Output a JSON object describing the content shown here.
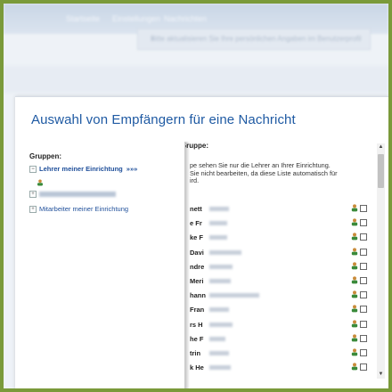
{
  "background": {
    "nav_items": [
      "Startseite",
      "Einstellungen",
      "Nachrichten"
    ],
    "notice_text": "Bitte aktualisieren Sie Ihre persönlichen Angaben im Benutzerprofil",
    "notice_close": "×"
  },
  "dialog": {
    "title": "Auswahl von Empfängern für eine Nachricht"
  },
  "groups": {
    "heading": "Gruppen:",
    "items": [
      {
        "sign": "−",
        "label": "Lehrer meiner Einrichtung",
        "arrows": "»»»",
        "selected": true
      },
      {
        "sign": "+",
        "label": ""
      },
      {
        "sign": "+",
        "label": "Mitarbeiter meiner Einrichtung"
      }
    ]
  },
  "users": {
    "heading": "Nutzer dieser Gruppe:",
    "info_lines": [
      "pe sehen Sie nur die Lehrer an Ihrer Einrichtung.",
      "Sie nicht bearbeiten, da diese Liste automatisch für",
      "ird."
    ],
    "rows": [
      {
        "name": "nett"
      },
      {
        "name": "e Fr"
      },
      {
        "name": "ke F"
      },
      {
        "name": "Davi"
      },
      {
        "name": "ndre"
      },
      {
        "name": "Meri"
      },
      {
        "name": "hann"
      },
      {
        "name": "Fran"
      },
      {
        "name": "rs H"
      },
      {
        "name": "he F"
      },
      {
        "name": "trin"
      },
      {
        "name": "k He"
      }
    ]
  },
  "scrollbar": {
    "up": "▲",
    "down": "▼"
  },
  "colors": {
    "title": "#1f5aa3",
    "frame": "#7a9a3a"
  }
}
